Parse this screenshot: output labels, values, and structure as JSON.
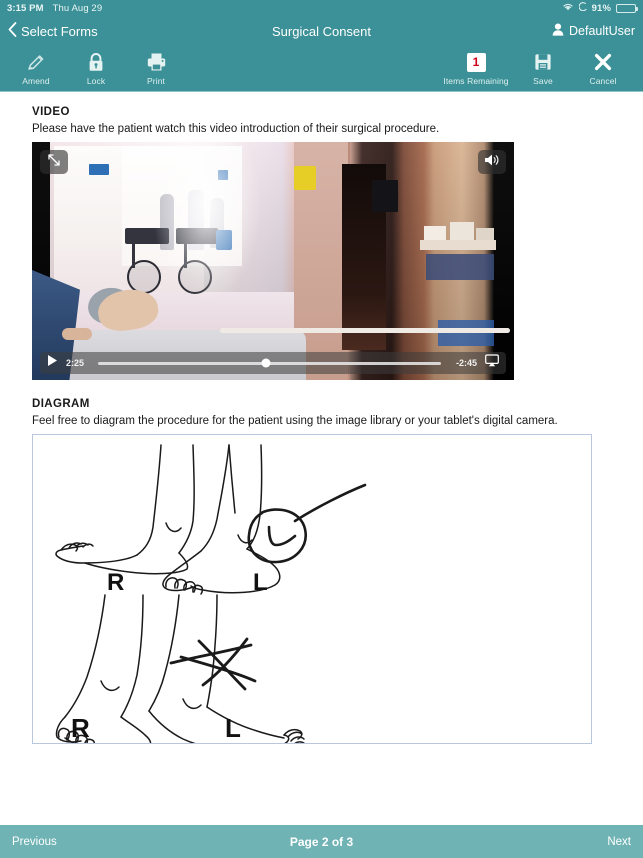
{
  "statusbar": {
    "time": "3:15 PM",
    "date": "Thu Aug 29",
    "battery_percent": "91%",
    "wifi_icon": "wifi-icon",
    "location_icon": "location-arrow-icon",
    "battery_icon": "battery-icon"
  },
  "navbar": {
    "back_label": "Select Forms",
    "back_icon": "chevron-left-icon",
    "title": "Surgical Consent",
    "user_label": "DefaultUser",
    "user_icon": "person-icon"
  },
  "toolbar": {
    "left_items": [
      {
        "label": "Amend",
        "icon": "pencil-icon"
      },
      {
        "label": "Lock",
        "icon": "lock-icon"
      },
      {
        "label": "Print",
        "icon": "printer-icon"
      }
    ],
    "right_items": [
      {
        "label": "Items Remaining",
        "icon": "badge-count",
        "count": "1"
      },
      {
        "label": "Save",
        "icon": "floppy-disk-icon"
      },
      {
        "label": "Cancel",
        "icon": "x-cross-icon"
      }
    ]
  },
  "content": {
    "video_section": {
      "heading": "VIDEO",
      "description": "Please have the patient watch this video introduction of their surgical procedure.",
      "player": {
        "expand_icon": "expand-arrows-icon",
        "volume_icon": "speaker-volume-icon",
        "play_icon": "play-icon",
        "current_time": "2:25",
        "remaining_time": "-2:45",
        "airplay_icon": "airplay-icon",
        "progress_percent": "49"
      }
    },
    "diagram_section": {
      "heading": "DIAGRAM",
      "description": "Feel free to diagram the procedure for the patient using the image library or your tablet's digital camera.",
      "figures": [
        {
          "name": "feet-side-view-top",
          "left_label": "R",
          "right_label": "L",
          "annotation": "circle-with-arrow"
        },
        {
          "name": "feet-side-view-bottom",
          "left_label": "R",
          "right_label": "L",
          "annotation": "x-mark-cross"
        }
      ]
    }
  },
  "bottombar": {
    "previous_label": "Previous",
    "page_label": "Page 2 of 3",
    "next_label": "Next"
  },
  "colors": {
    "teal_header": "#3b9197",
    "teal_footer": "#6fb3b4",
    "badge_red": "#d0021b",
    "diagram_border": "#b9c6dd"
  }
}
